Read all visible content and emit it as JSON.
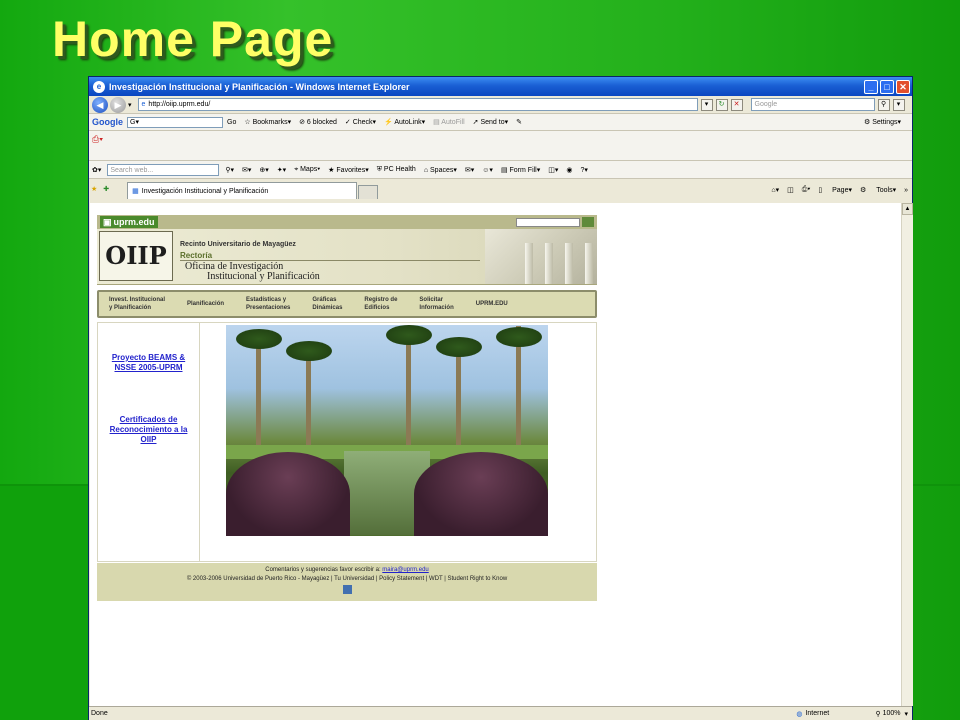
{
  "slide": {
    "title": "Home Page"
  },
  "window": {
    "title": "Investigación Institucional y Planificación - Windows Internet Explorer",
    "address": "http://oiip.uprm.edu/",
    "search_placeholder": "Google",
    "status": "Done",
    "zone": "Internet",
    "zoom": "100%"
  },
  "google_toolbar": {
    "logo": "Google",
    "go": "Go",
    "bookmarks": "Bookmarks",
    "blocked": "6 blocked",
    "check": "Check",
    "autolink": "AutoLink",
    "autofill": "AutoFill",
    "send_to": "Send to",
    "settings": "Settings"
  },
  "windows_live_toolbar": {
    "search_placeholder": "Search web...",
    "maps": "Maps",
    "favorites": "Favorites",
    "pc_health": "PC Health",
    "spaces": "Spaces",
    "form_fill": "Form Fill"
  },
  "tab": {
    "label": "Investigación Institucional y Planificación",
    "page": "Page",
    "tools": "Tools"
  },
  "site": {
    "uprm_logo": "uprm.edu",
    "logo_text": "OIIP",
    "recinto": "Recinto Universitario de Mayagüez",
    "rectoria": "Rectoría",
    "oficina_line1": "Oficina de Investigación",
    "oficina_line2": "Institucional y Planificación",
    "menu": [
      {
        "line1": "Invest. Institucional",
        "line2": "y Planificación"
      },
      {
        "line1": "Planificación",
        "line2": ""
      },
      {
        "line1": "Estadísticas y",
        "line2": "Presentaciones"
      },
      {
        "line1": "Gráficas",
        "line2": "Dinámicas"
      },
      {
        "line1": "Registro de",
        "line2": "Edificios"
      },
      {
        "line1": "Solicitar",
        "line2": "Información"
      },
      {
        "line1": "UPRM.EDU",
        "line2": ""
      }
    ],
    "links": [
      "Proyecto BEAMS & NSSE 2005-UPRM",
      "Certificados de Reconocimiento a la OIIP"
    ],
    "footer": {
      "contact_text": "Comentarios y sugerencias favor escribir a:",
      "email": "maira@uprm.edu",
      "copyright": "© 2003-2006 Universidad de Puerto Rico - Mayagüez | Tu Universidad | Policy Statement | WDT | Student Right to Know"
    }
  }
}
